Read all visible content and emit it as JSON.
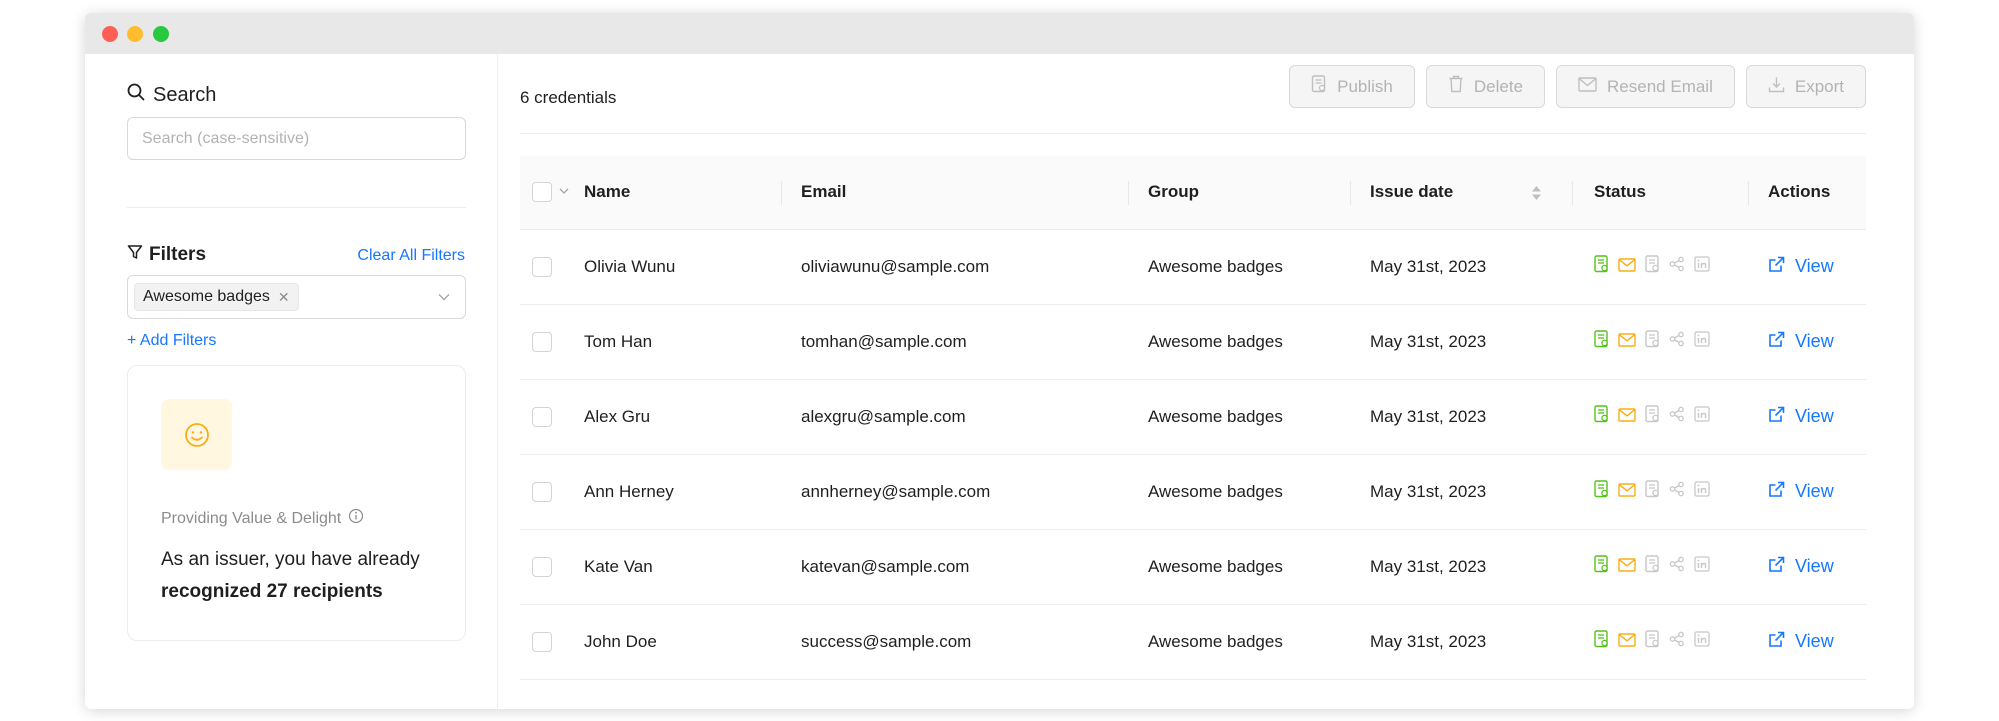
{
  "window": {
    "dots": [
      "close",
      "minimize",
      "maximize"
    ]
  },
  "sidebar": {
    "search_title": "Search",
    "search_placeholder": "Search (case-sensitive)",
    "filters_title": "Filters",
    "clear_filters": "Clear All Filters",
    "selected_filter": "Awesome badges",
    "add_filters": "+ Add Filters",
    "card": {
      "label": "Providing Value & Delight",
      "text_prefix": "As an issuer, you have already",
      "text_bold": "recognized 27 recipients"
    }
  },
  "main": {
    "count": "6 credentials",
    "toolbar": {
      "publish": "Publish",
      "delete": "Delete",
      "resend": "Resend Email",
      "export": "Export"
    },
    "columns": {
      "name": "Name",
      "email": "Email",
      "group": "Group",
      "issue_date": "Issue date",
      "status": "Status",
      "actions": "Actions"
    },
    "rows": [
      {
        "name": "Olivia Wunu",
        "email": "oliviawunu@sample.com",
        "group": "Awesome badges",
        "date": "May 31st, 2023",
        "action": "View"
      },
      {
        "name": "Tom Han",
        "email": "tomhan@sample.com",
        "group": "Awesome badges",
        "date": "May 31st, 2023",
        "action": "View"
      },
      {
        "name": "Alex Gru",
        "email": "alexgru@sample.com",
        "group": "Awesome badges",
        "date": "May 31st, 2023",
        "action": "View"
      },
      {
        "name": "Ann Herney",
        "email": "annherney@sample.com",
        "group": "Awesome badges",
        "date": "May 31st, 2023",
        "action": "View"
      },
      {
        "name": "Kate Van",
        "email": "katevan@sample.com",
        "group": "Awesome badges",
        "date": "May 31st, 2023",
        "action": "View"
      },
      {
        "name": "John Doe",
        "email": "success@sample.com",
        "group": "Awesome badges",
        "date": "May 31st, 2023",
        "action": "View"
      }
    ],
    "status_icons": [
      "issued-doc-icon",
      "email-sent-icon",
      "published-doc-icon",
      "share-icon",
      "linkedin-icon"
    ],
    "colors": {
      "accent": "#1677ff",
      "issued": "#52c41a",
      "email": "#faad14",
      "inactive": "#c8c8c8"
    }
  }
}
